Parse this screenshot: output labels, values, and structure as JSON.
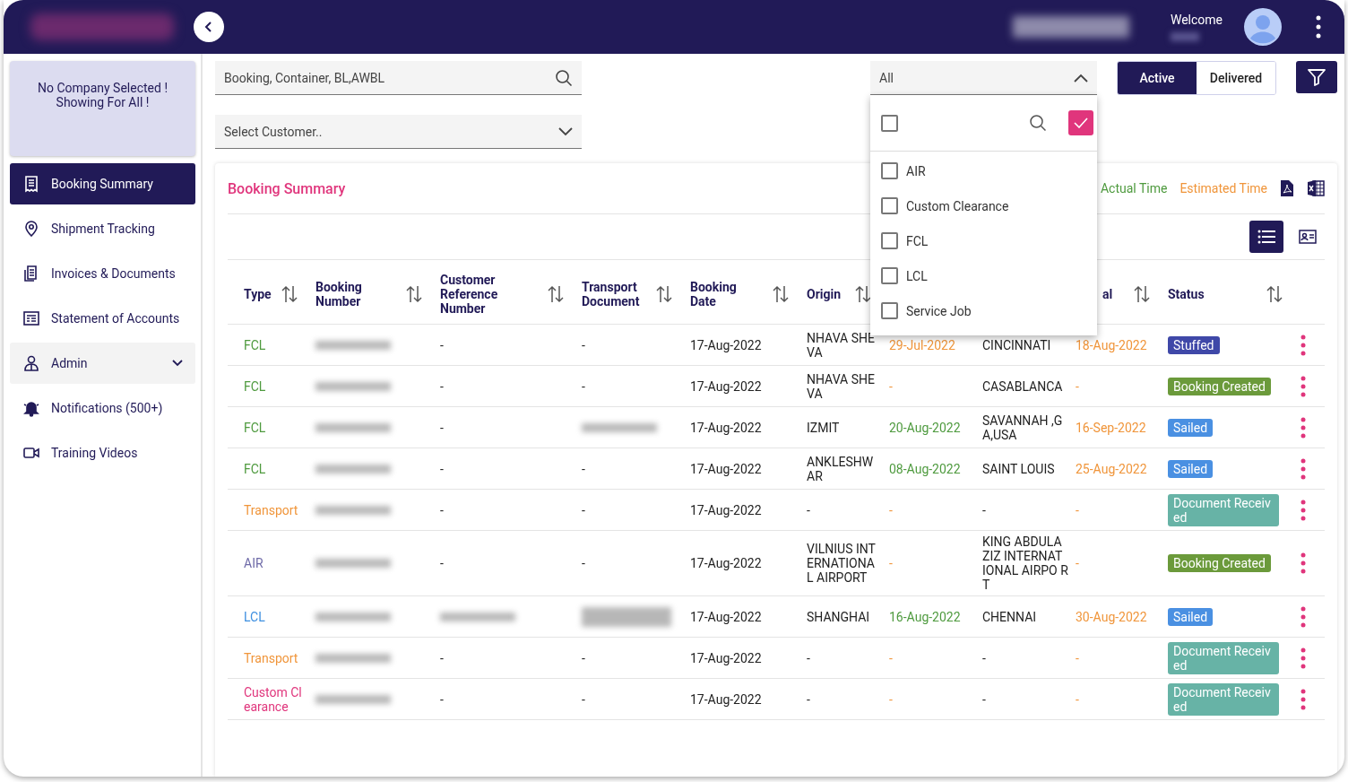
{
  "header": {
    "welcome": "Welcome"
  },
  "sidebar": {
    "notice": [
      "No Company Selected !",
      "Showing For All !"
    ],
    "items": [
      {
        "label": "Booking Summary",
        "selected": true,
        "kind": "link"
      },
      {
        "label": "Shipment Tracking",
        "selected": false,
        "kind": "link"
      },
      {
        "label": "Invoices & Documents",
        "selected": false,
        "kind": "link"
      },
      {
        "label": "Statement of Accounts",
        "selected": false,
        "kind": "link"
      },
      {
        "label": "Admin",
        "selected": false,
        "kind": "group",
        "expanded": false
      },
      {
        "label": "Notifications (500+)",
        "selected": false,
        "kind": "link"
      },
      {
        "label": "Training Videos",
        "selected": false,
        "kind": "link"
      }
    ]
  },
  "filters": {
    "search": {
      "placeholder": "Booking, Container, BL,AWBL"
    },
    "customer": {
      "placeholder": "Select Customer.."
    },
    "type_select": {
      "value": "All",
      "expanded": true,
      "select_all_checked": false,
      "options": [
        {
          "label": "AIR",
          "checked": false
        },
        {
          "label": "Custom Clearance",
          "checked": false
        },
        {
          "label": "FCL",
          "checked": false
        },
        {
          "label": "LCL",
          "checked": false
        },
        {
          "label": "Service Job",
          "checked": false
        }
      ]
    },
    "status_toggle": [
      {
        "label": "Active",
        "selected": true
      },
      {
        "label": "Delivered",
        "selected": false
      }
    ]
  },
  "card": {
    "title": "Booking Summary",
    "legend": [
      {
        "label": "Actual Time",
        "color": "#4e9a3e"
      },
      {
        "label": "Estimated Time",
        "color": "#f0953a"
      }
    ],
    "views": [
      {
        "selected": true
      },
      {
        "selected": false
      }
    ],
    "columns": [
      {
        "label": "Type"
      },
      {
        "label": "Booking Number"
      },
      {
        "label": "Customer Reference Number"
      },
      {
        "label": "Transport Document"
      },
      {
        "label": "Booking Date"
      },
      {
        "label": "Origin"
      },
      null,
      null,
      {
        "label": "al"
      },
      {
        "label": "Status"
      }
    ],
    "rows": [
      {
        "cells": [
          {
            "kind": "type",
            "text": "FCL",
            "color": "#4e9a3e"
          },
          {
            "kind": "redacted"
          },
          {
            "kind": "plain",
            "text": "-"
          },
          {
            "kind": "plain",
            "text": "-"
          },
          {
            "kind": "plain",
            "text": "17-Aug-2022"
          },
          {
            "kind": "plain",
            "text": "NHAVA SHE VA"
          },
          {
            "kind": "estimated",
            "text": "29-Jul-2022"
          },
          {
            "kind": "plain",
            "text": "CINCINNATI"
          },
          {
            "kind": "estimated",
            "text": "18-Aug-2022"
          },
          {
            "kind": "status",
            "text": "Stuffed",
            "color": "#3f48a8"
          }
        ]
      },
      {
        "cells": [
          {
            "kind": "type",
            "text": "FCL",
            "color": "#4e9a3e"
          },
          {
            "kind": "redacted"
          },
          {
            "kind": "plain",
            "text": "-"
          },
          {
            "kind": "plain",
            "text": "-"
          },
          {
            "kind": "plain",
            "text": "17-Aug-2022"
          },
          {
            "kind": "plain",
            "text": "NHAVA SHE VA"
          },
          {
            "kind": "estimated",
            "text": "-"
          },
          {
            "kind": "plain",
            "text": "CASABLANCA"
          },
          {
            "kind": "estimated",
            "text": "-"
          },
          {
            "kind": "status",
            "text": "Booking Created",
            "color": "#6b9a3b"
          }
        ]
      },
      {
        "cells": [
          {
            "kind": "type",
            "text": "FCL",
            "color": "#4e9a3e"
          },
          {
            "kind": "redacted"
          },
          {
            "kind": "plain",
            "text": "-"
          },
          {
            "kind": "redacted"
          },
          {
            "kind": "plain",
            "text": "17-Aug-2022"
          },
          {
            "kind": "plain",
            "text": "IZMIT"
          },
          {
            "kind": "actual",
            "text": "20-Aug-2022"
          },
          {
            "kind": "plain",
            "text": "SAVANNAH ,G A,USA"
          },
          {
            "kind": "estimated",
            "text": "16-Sep-2022"
          },
          {
            "kind": "status",
            "text": "Sailed",
            "color": "#4a90e2"
          }
        ]
      },
      {
        "cells": [
          {
            "kind": "type",
            "text": "FCL",
            "color": "#4e9a3e"
          },
          {
            "kind": "redacted"
          },
          {
            "kind": "plain",
            "text": "-"
          },
          {
            "kind": "plain",
            "text": "-"
          },
          {
            "kind": "plain",
            "text": "17-Aug-2022"
          },
          {
            "kind": "plain",
            "text": "ANKLESHW AR"
          },
          {
            "kind": "actual",
            "text": "08-Aug-2022"
          },
          {
            "kind": "plain",
            "text": "SAINT LOUIS"
          },
          {
            "kind": "estimated",
            "text": "25-Aug-2022"
          },
          {
            "kind": "status",
            "text": "Sailed",
            "color": "#4a90e2"
          }
        ]
      },
      {
        "cells": [
          {
            "kind": "type",
            "text": "Transport",
            "color": "#f0953a"
          },
          {
            "kind": "redacted"
          },
          {
            "kind": "plain",
            "text": "-"
          },
          {
            "kind": "plain",
            "text": "-"
          },
          {
            "kind": "plain",
            "text": "17-Aug-2022"
          },
          {
            "kind": "plain",
            "text": "-"
          },
          {
            "kind": "estimated",
            "text": "-"
          },
          {
            "kind": "plain",
            "text": "-"
          },
          {
            "kind": "estimated",
            "text": "-"
          },
          {
            "kind": "status",
            "text": "Document Receiv ed",
            "color": "#67b3a6"
          }
        ]
      },
      {
        "cells": [
          {
            "kind": "type",
            "text": "AIR",
            "color": "#6e6aa8"
          },
          {
            "kind": "redacted"
          },
          {
            "kind": "plain",
            "text": "-"
          },
          {
            "kind": "plain",
            "text": "-"
          },
          {
            "kind": "plain",
            "text": "17-Aug-2022"
          },
          {
            "kind": "plain",
            "text": "VILNIUS INT ERNATIONA L AIRPORT"
          },
          {
            "kind": "estimated",
            "text": "-"
          },
          {
            "kind": "plain",
            "text": "KING ABDULA ZIZ INTERNAT IONAL AIRPO RT"
          },
          {
            "kind": "estimated",
            "text": "-"
          },
          {
            "kind": "status",
            "text": "Booking Created",
            "color": "#6b9a3b"
          }
        ]
      },
      {
        "cells": [
          {
            "kind": "type",
            "text": "LCL",
            "color": "#3d8fe0"
          },
          {
            "kind": "redacted"
          },
          {
            "kind": "redacted"
          },
          {
            "kind": "redacted2"
          },
          {
            "kind": "plain",
            "text": "17-Aug-2022"
          },
          {
            "kind": "plain",
            "text": "SHANGHAI"
          },
          {
            "kind": "actual",
            "text": "16-Aug-2022"
          },
          {
            "kind": "plain",
            "text": "CHENNAI"
          },
          {
            "kind": "estimated",
            "text": "30-Aug-2022"
          },
          {
            "kind": "status",
            "text": "Sailed",
            "color": "#4a90e2"
          }
        ]
      },
      {
        "cells": [
          {
            "kind": "type",
            "text": "Transport",
            "color": "#f0953a"
          },
          {
            "kind": "redacted"
          },
          {
            "kind": "plain",
            "text": "-"
          },
          {
            "kind": "plain",
            "text": "-"
          },
          {
            "kind": "plain",
            "text": "17-Aug-2022"
          },
          {
            "kind": "plain",
            "text": "-"
          },
          {
            "kind": "estimated",
            "text": "-"
          },
          {
            "kind": "plain",
            "text": "-"
          },
          {
            "kind": "estimated",
            "text": "-"
          },
          {
            "kind": "status",
            "text": "Document Receiv ed",
            "color": "#67b3a6"
          }
        ]
      },
      {
        "cells": [
          {
            "kind": "type",
            "text": "Custom Cl earance",
            "color": "#e0357c"
          },
          {
            "kind": "redacted"
          },
          {
            "kind": "plain",
            "text": "-"
          },
          {
            "kind": "plain",
            "text": "-"
          },
          {
            "kind": "plain",
            "text": "17-Aug-2022"
          },
          {
            "kind": "plain",
            "text": "-"
          },
          {
            "kind": "estimated",
            "text": "-"
          },
          {
            "kind": "plain",
            "text": "-"
          },
          {
            "kind": "estimated",
            "text": "-"
          },
          {
            "kind": "status",
            "text": "Document Receiv ed",
            "color": "#67b3a6"
          }
        ]
      }
    ]
  }
}
